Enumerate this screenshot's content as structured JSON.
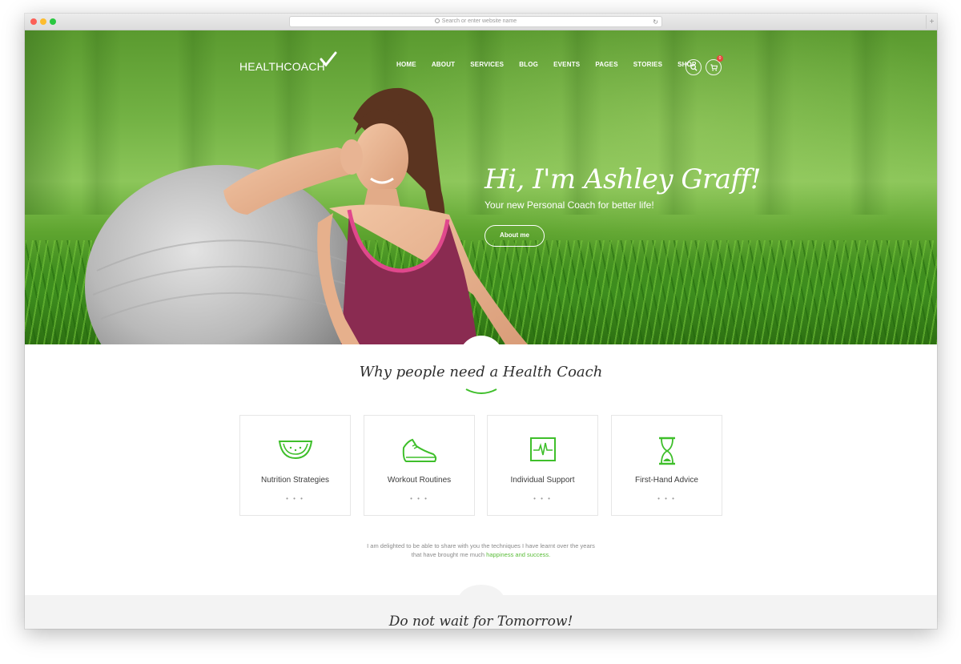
{
  "browser": {
    "url_placeholder": "Search or enter website name",
    "new_tab_label": "+"
  },
  "header": {
    "logo": "HEALTHCOACH",
    "nav": [
      "HOME",
      "ABOUT",
      "SERVICES",
      "BLOG",
      "EVENTS",
      "PAGES",
      "STORIES",
      "SHOP"
    ],
    "cart_count": "0"
  },
  "hero": {
    "title": "Hi, I'm Ashley Graff!",
    "subtitle": "Your new Personal Coach for better life!",
    "button": "About me"
  },
  "why": {
    "title": "Why people need a Health Coach",
    "cards": [
      {
        "icon": "watermelon-icon",
        "label": "Nutrition Strategies",
        "dots": "• • •"
      },
      {
        "icon": "sneaker-icon",
        "label": "Workout Routines",
        "dots": "• • •"
      },
      {
        "icon": "heartbeat-monitor-icon",
        "label": "Individual Support",
        "dots": "• • •"
      },
      {
        "icon": "hourglass-icon",
        "label": "First-Hand Advice",
        "dots": "• • •"
      }
    ]
  },
  "intro": {
    "line1": "I am delighted to be able to share with you the techniques I have learnt over the years",
    "line2_prefix": "that have brought me much ",
    "line2_highlight": "happiness and success."
  },
  "next_section": {
    "title": "Do not wait for Tomorrow!"
  },
  "colors": {
    "accent": "#3fbf2b",
    "badge": "#e6463c"
  }
}
